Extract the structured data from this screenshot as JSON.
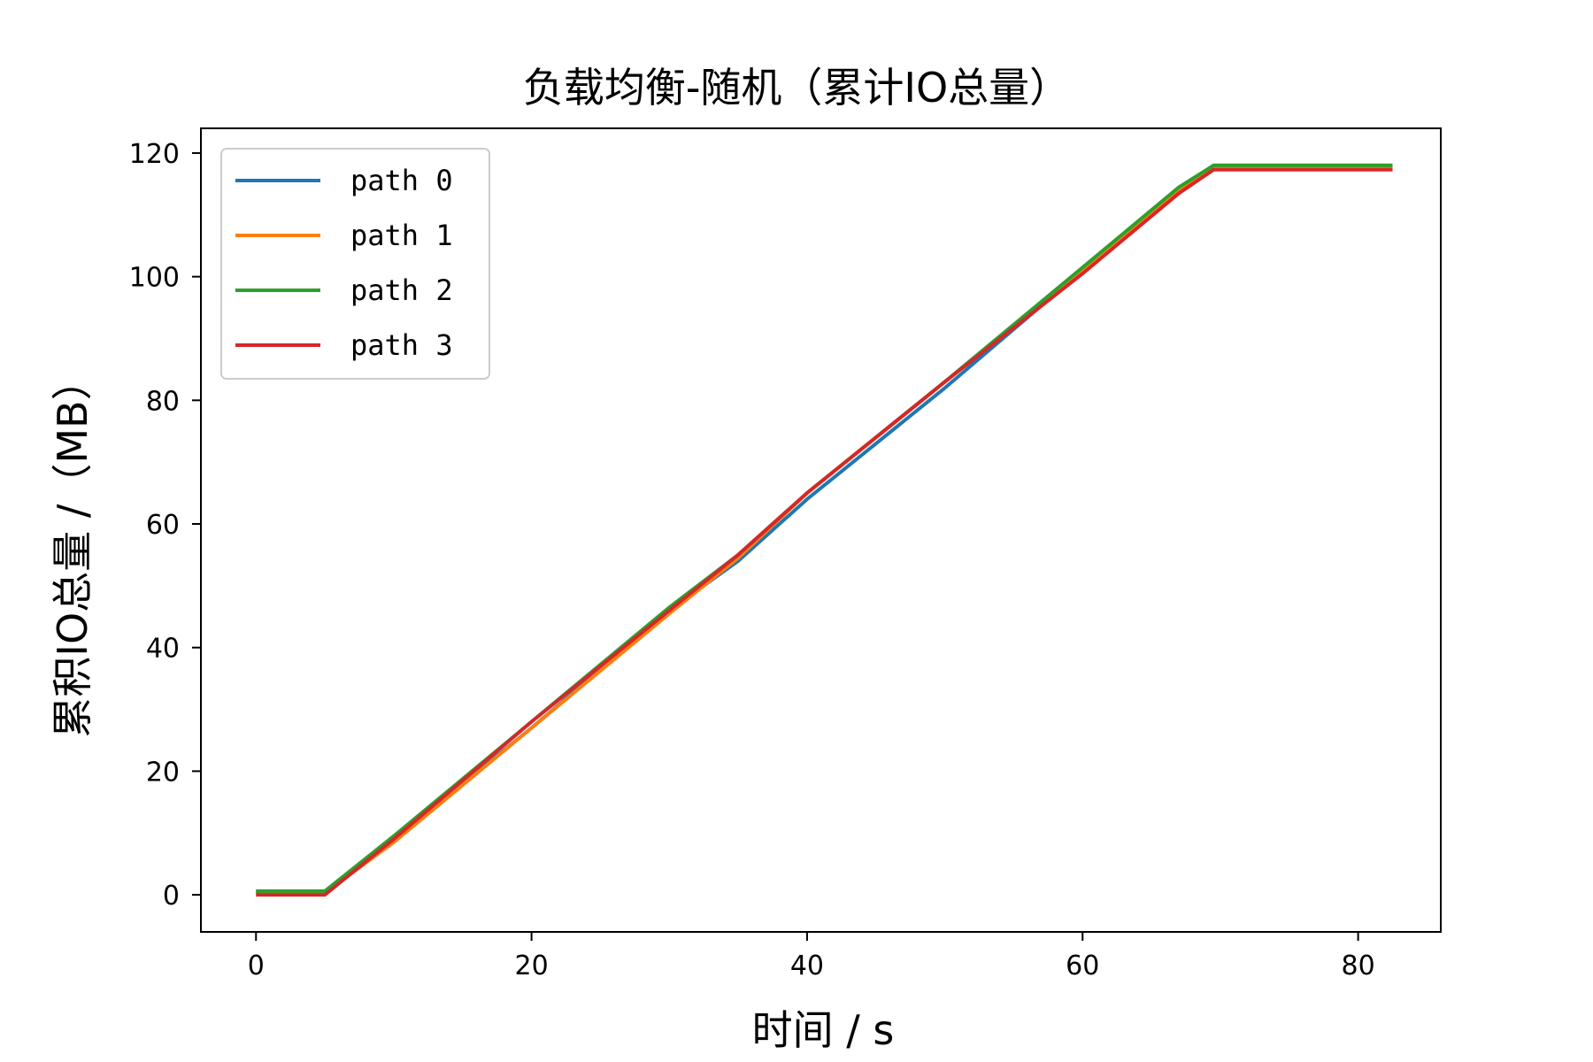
{
  "chart_data": {
    "type": "line",
    "title": "负载均衡-随机（累计IO总量）",
    "xlabel": "时间 / s",
    "ylabel": "累积IO总量 /（MB）",
    "xlim": [
      -4,
      86
    ],
    "ylim": [
      -6,
      124
    ],
    "xticks": [
      0,
      20,
      40,
      60,
      80
    ],
    "yticks": [
      0,
      20,
      40,
      60,
      80,
      100,
      120
    ],
    "grid": false,
    "legend_position": "top-left",
    "series": [
      {
        "name": "path 0",
        "color": "#1f77b4",
        "x": [
          0,
          5,
          10,
          20,
          30,
          35,
          40,
          50,
          60,
          67,
          69.5,
          82.5
        ],
        "y": [
          0.5,
          0.5,
          9,
          27,
          46,
          54,
          64,
          82,
          101,
          114,
          118,
          118
        ]
      },
      {
        "name": "path 1",
        "color": "#ff7f0e",
        "x": [
          0,
          5,
          10,
          20,
          30,
          35,
          40,
          50,
          60,
          67,
          69.5,
          82.5
        ],
        "y": [
          0.3,
          0.3,
          8.5,
          27,
          45.5,
          54.5,
          65,
          83,
          101,
          114,
          117.8,
          117.8
        ]
      },
      {
        "name": "path 2",
        "color": "#2ca02c",
        "x": [
          0,
          5,
          10,
          20,
          30,
          35,
          40,
          50,
          60,
          67,
          69.5,
          82.5
        ],
        "y": [
          0.6,
          0.6,
          9.5,
          28,
          46.5,
          55,
          65,
          83,
          101.5,
          114.5,
          118,
          118
        ]
      },
      {
        "name": "path 3",
        "color": "#d62728",
        "x": [
          0,
          5,
          10,
          20,
          30,
          35,
          40,
          50,
          60,
          67,
          69.5,
          82.5
        ],
        "y": [
          0,
          0,
          9,
          28,
          46,
          55,
          65,
          83,
          100.5,
          113.5,
          117.3,
          117.3
        ]
      }
    ]
  }
}
